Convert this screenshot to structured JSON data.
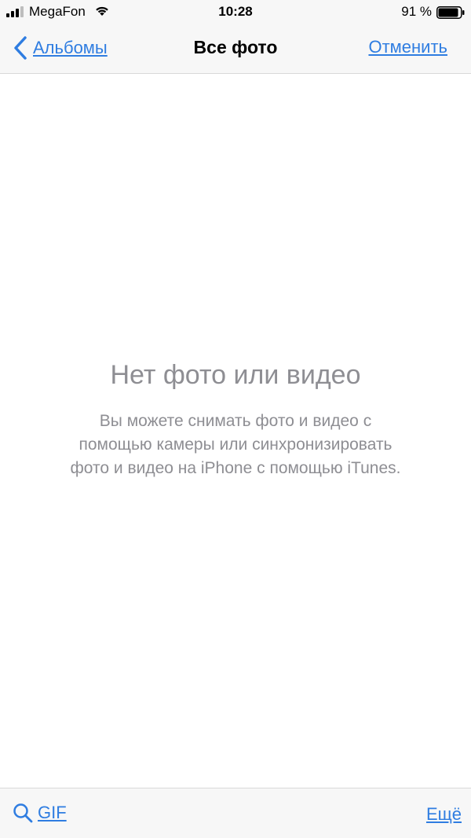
{
  "status_bar": {
    "carrier": "MegaFon",
    "time": "10:28",
    "battery_percent": "91 %",
    "battery_level": 0.91,
    "signal_icon": "signal-bars-icon",
    "wifi_icon": "wifi-icon",
    "battery_icon": "battery-icon"
  },
  "nav": {
    "back_label": "Альбомы",
    "back_icon": "chevron-left-icon",
    "title": "Все фото",
    "cancel_label": "Отменить"
  },
  "empty_state": {
    "title": "Нет фото или видео",
    "line1": "Вы можете снимать фото и видео с",
    "line2": "помощью камеры или синхронизировать",
    "line3": "фото и видео на iPhone с помощью iTunes."
  },
  "toolbar": {
    "search_icon": "search-icon",
    "search_label": "GIF",
    "more_label": "Ещё"
  },
  "colors": {
    "accent": "#2f7de1",
    "secondary_text": "#8e8e93",
    "bar_background": "#f7f7f7"
  }
}
